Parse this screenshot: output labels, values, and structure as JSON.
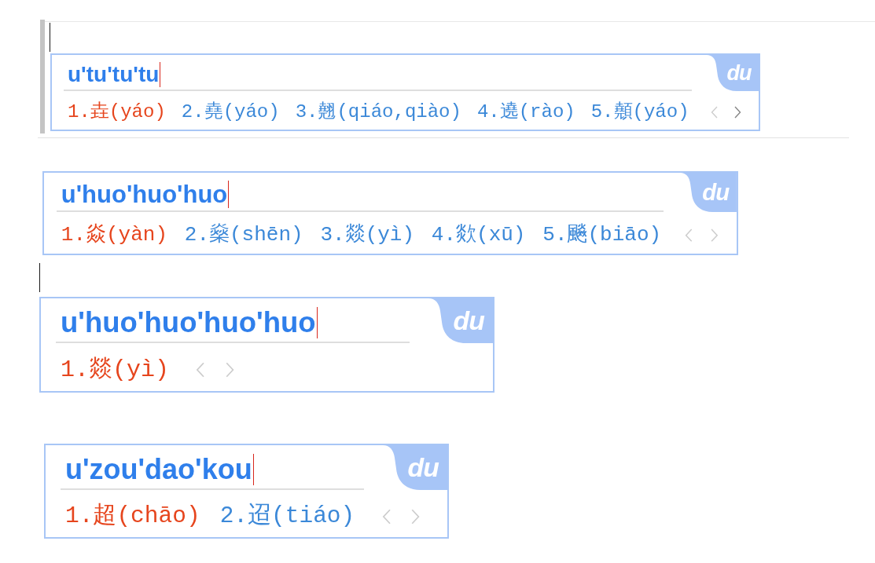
{
  "ime_popups": [
    {
      "host_window_frame": true,
      "document_cursor": true,
      "composition": "u'tu'tu'tu",
      "logo": "du",
      "candidates": [
        {
          "text": "1.垚(yáo)",
          "selected": true
        },
        {
          "text": "2.堯(yáo)",
          "selected": false
        },
        {
          "text": "3.翹(qiáo,qiào)",
          "selected": false
        },
        {
          "text": "4.遶(rào)",
          "selected": false
        },
        {
          "text": "5.顤(yáo)",
          "selected": false
        }
      ],
      "prev_page": {
        "disabled": true
      },
      "next_page": {
        "disabled": false
      }
    },
    {
      "host_window_frame": false,
      "document_cursor": false,
      "composition": "u'huo'huo'huo",
      "logo": "du",
      "candidates": [
        {
          "text": "1.焱(yàn)",
          "selected": true
        },
        {
          "text": "2.燊(shēn)",
          "selected": false
        },
        {
          "text": "3.燚(yì)",
          "selected": false
        },
        {
          "text": "4.欻(xū)",
          "selected": false
        },
        {
          "text": "5.飈(biāo)",
          "selected": false
        }
      ],
      "prev_page": {
        "disabled": true
      },
      "next_page": {
        "disabled": true
      }
    },
    {
      "host_window_frame": false,
      "document_cursor": true,
      "composition": "u'huo'huo'huo'huo",
      "logo": "du",
      "candidates": [
        {
          "text": "1.燚(yì)",
          "selected": true
        }
      ],
      "prev_page": {
        "disabled": true
      },
      "next_page": {
        "disabled": true
      }
    },
    {
      "host_window_frame": false,
      "document_cursor": false,
      "composition": "u'zou'dao'kou",
      "logo": "du",
      "candidates": [
        {
          "text": "1.超(chāo)",
          "selected": true
        },
        {
          "text": "2.迢(tiáo)",
          "selected": false
        }
      ],
      "prev_page": {
        "disabled": true
      },
      "next_page": {
        "disabled": true
      }
    }
  ]
}
